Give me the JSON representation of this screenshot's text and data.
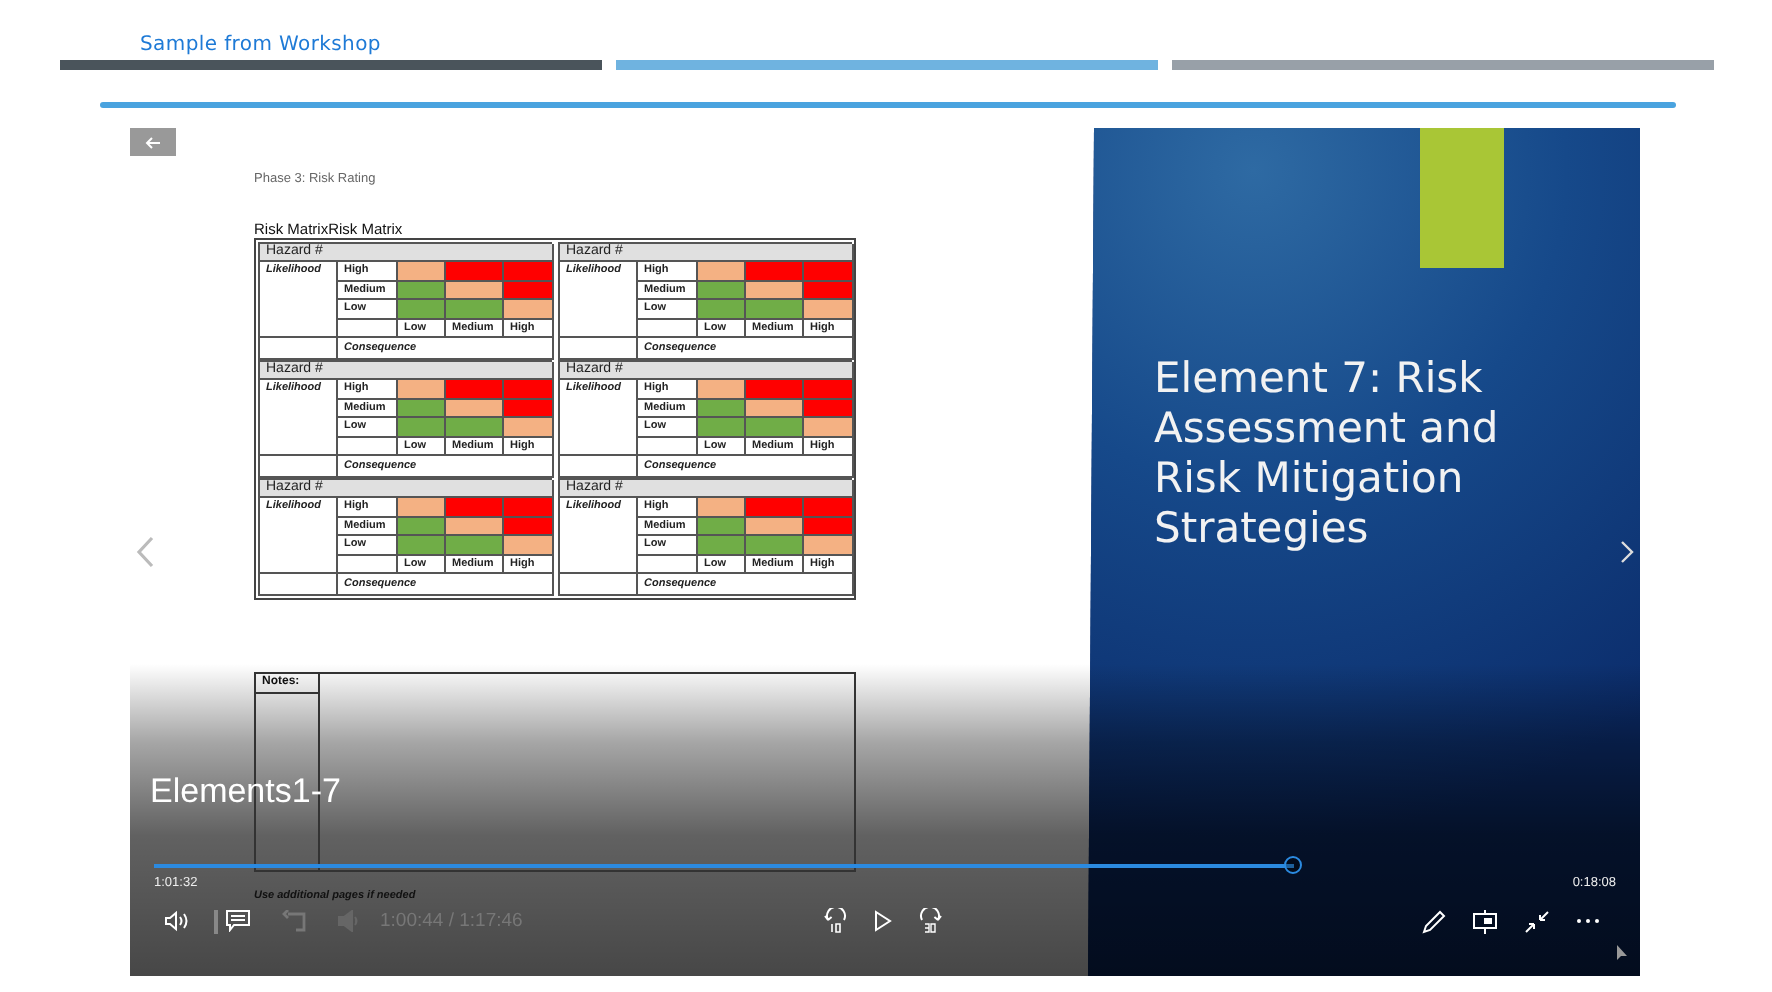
{
  "header": {
    "title": "Sample from Workshop"
  },
  "player": {
    "document": {
      "heading": "Phase 3: Risk Rating",
      "caption": "Risk MatrixRisk Matrix",
      "matrices": [
        {
          "hazard": "Hazard #",
          "likelihood": "Likelihood",
          "rows": [
            {
              "label": "High",
              "cells": [
                {
                  "color": "#f4b183"
                },
                {
                  "color": "#ff0000"
                },
                {
                  "color": "#ff0000"
                }
              ]
            },
            {
              "label": "Medium",
              "cells": [
                {
                  "color": "#70ad47"
                },
                {
                  "color": "#f4b183"
                },
                {
                  "color": "#ff0000"
                }
              ]
            },
            {
              "label": "Low",
              "cells": [
                {
                  "color": "#70ad47"
                },
                {
                  "color": "#70ad47"
                },
                {
                  "color": "#f4b183"
                }
              ]
            }
          ],
          "columns": [
            "Low",
            "Medium",
            "High"
          ],
          "consequence": "Consequence"
        },
        {
          "hazard": "Hazard #",
          "likelihood": "Likelihood",
          "rows": [
            {
              "label": "High",
              "cells": [
                {
                  "color": "#f4b183"
                },
                {
                  "color": "#ff0000"
                },
                {
                  "color": "#ff0000"
                }
              ]
            },
            {
              "label": "Medium",
              "cells": [
                {
                  "color": "#70ad47"
                },
                {
                  "color": "#f4b183"
                },
                {
                  "color": "#ff0000"
                }
              ]
            },
            {
              "label": "Low",
              "cells": [
                {
                  "color": "#70ad47"
                },
                {
                  "color": "#70ad47"
                },
                {
                  "color": "#f4b183"
                }
              ]
            }
          ],
          "columns": [
            "Low",
            "Medium",
            "High"
          ],
          "consequence": "Consequence"
        },
        {
          "hazard": "Hazard #",
          "likelihood": "Likelihood",
          "rows": [
            {
              "label": "High",
              "cells": [
                {
                  "color": "#f4b183"
                },
                {
                  "color": "#ff0000"
                },
                {
                  "color": "#ff0000"
                }
              ]
            },
            {
              "label": "Medium",
              "cells": [
                {
                  "color": "#70ad47"
                },
                {
                  "color": "#f4b183"
                },
                {
                  "color": "#ff0000"
                }
              ]
            },
            {
              "label": "Low",
              "cells": [
                {
                  "color": "#70ad47"
                },
                {
                  "color": "#70ad47"
                },
                {
                  "color": "#f4b183"
                }
              ]
            }
          ],
          "columns": [
            "Low",
            "Medium",
            "High"
          ],
          "consequence": "Consequence"
        },
        {
          "hazard": "Hazard #",
          "likelihood": "Likelihood",
          "rows": [
            {
              "label": "High",
              "cells": [
                {
                  "color": "#f4b183"
                },
                {
                  "color": "#ff0000"
                },
                {
                  "color": "#ff0000"
                }
              ]
            },
            {
              "label": "Medium",
              "cells": [
                {
                  "color": "#70ad47"
                },
                {
                  "color": "#f4b183"
                },
                {
                  "color": "#ff0000"
                }
              ]
            },
            {
              "label": "Low",
              "cells": [
                {
                  "color": "#70ad47"
                },
                {
                  "color": "#70ad47"
                },
                {
                  "color": "#f4b183"
                }
              ]
            }
          ],
          "columns": [
            "Low",
            "Medium",
            "High"
          ],
          "consequence": "Consequence"
        },
        {
          "hazard": "Hazard #",
          "likelihood": "Likelihood",
          "rows": [
            {
              "label": "High",
              "cells": [
                {
                  "color": "#f4b183"
                },
                {
                  "color": "#ff0000"
                },
                {
                  "color": "#ff0000"
                }
              ]
            },
            {
              "label": "Medium",
              "cells": [
                {
                  "color": "#70ad47"
                },
                {
                  "color": "#f4b183"
                },
                {
                  "color": "#ff0000"
                }
              ]
            },
            {
              "label": "Low",
              "cells": [
                {
                  "color": "#70ad47"
                },
                {
                  "color": "#70ad47"
                },
                {
                  "color": "#f4b183"
                }
              ]
            }
          ],
          "columns": [
            "Low",
            "Medium",
            "High"
          ],
          "consequence": "Consequence"
        },
        {
          "hazard": "Hazard #",
          "likelihood": "Likelihood",
          "rows": [
            {
              "label": "High",
              "cells": [
                {
                  "color": "#f4b183"
                },
                {
                  "color": "#ff0000"
                },
                {
                  "color": "#ff0000"
                }
              ]
            },
            {
              "label": "Medium",
              "cells": [
                {
                  "color": "#70ad47"
                },
                {
                  "color": "#f4b183"
                },
                {
                  "color": "#ff0000"
                }
              ]
            },
            {
              "label": "Low",
              "cells": [
                {
                  "color": "#70ad47"
                },
                {
                  "color": "#70ad47"
                },
                {
                  "color": "#f4b183"
                }
              ]
            }
          ],
          "columns": [
            "Low",
            "Medium",
            "High"
          ],
          "consequence": "Consequence"
        }
      ],
      "notes_label": "Notes:",
      "footer_note": "Use additional pages if needed"
    },
    "slide": {
      "title": "Element 7: Risk Assessment and Risk Mitigation Strategies"
    },
    "video_title": "Elements1-7",
    "progress": {
      "level": 0.78,
      "elapsed": "1:01:32",
      "remaining": "0:18:08"
    },
    "background_time": "1:00:44 / 1:17:46"
  }
}
